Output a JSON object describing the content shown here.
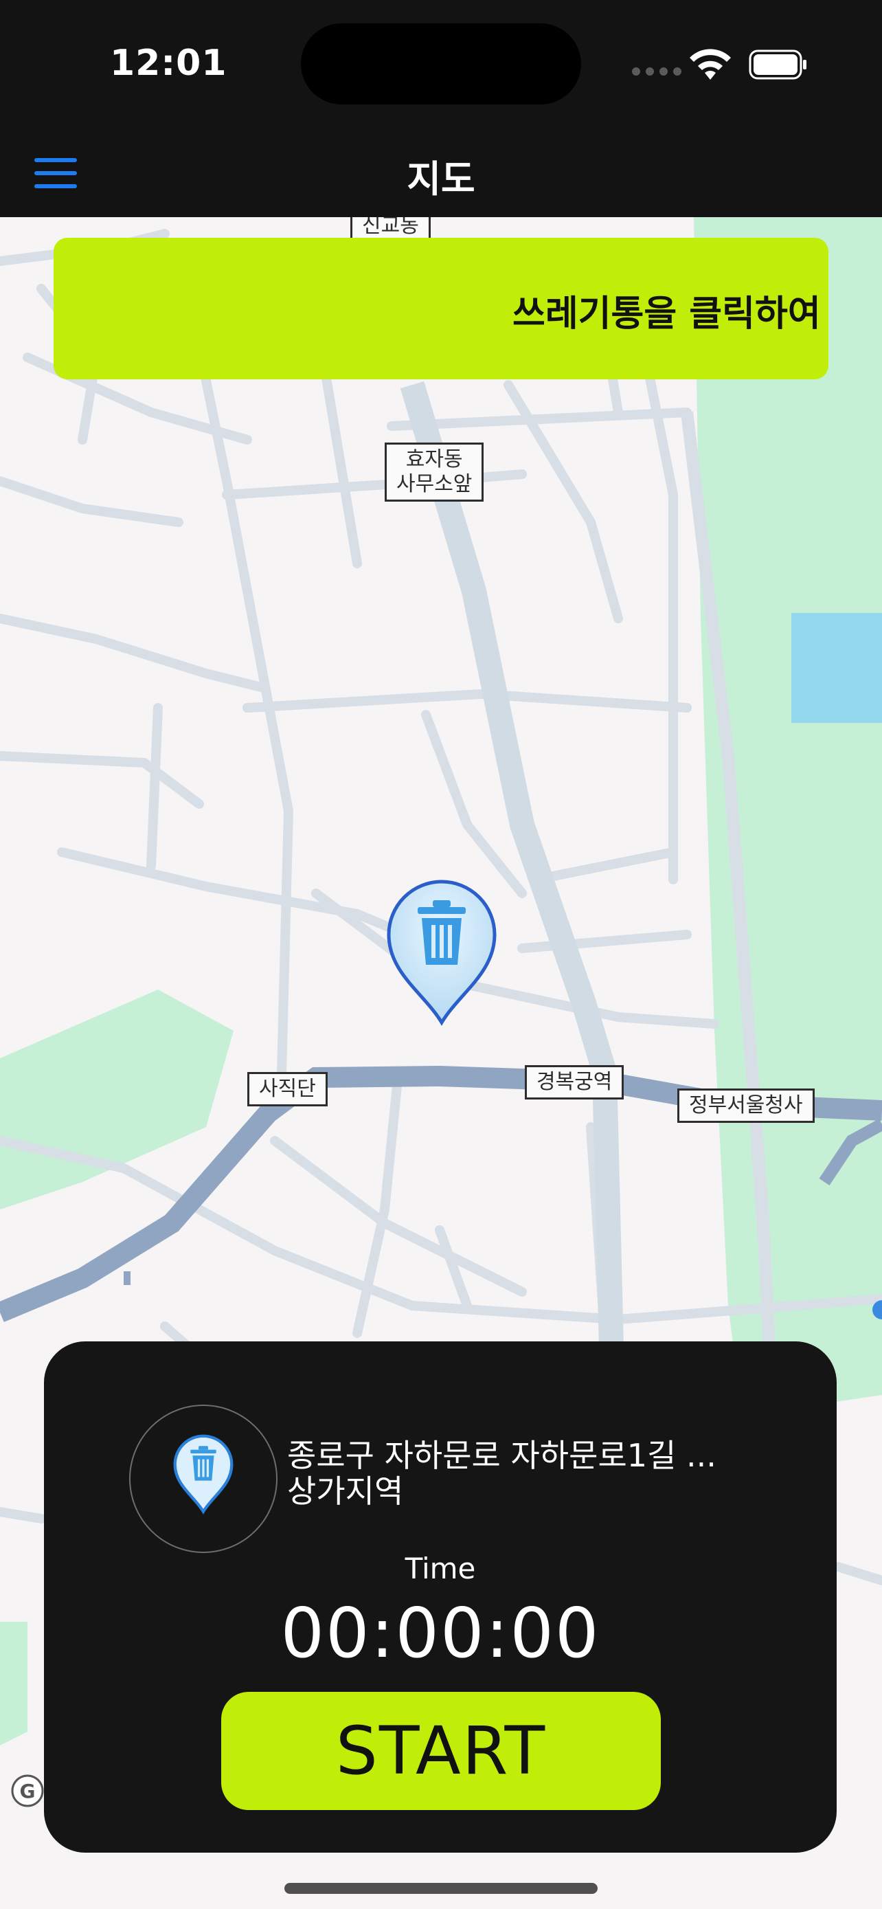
{
  "status_bar": {
    "time": "12:01"
  },
  "nav": {
    "title": "지도"
  },
  "banner": {
    "text": "쓰레기통을 클릭하여"
  },
  "map": {
    "labels": {
      "top_cut": "신교동",
      "hyoja": "효자동\n사무소앞",
      "sajik": "사직단",
      "gyeongbok": "경복궁역",
      "gov": "정부서울청사"
    }
  },
  "panel": {
    "address_line1": "종로구 자하문로 자하문로1길 ...",
    "address_line2": "상가지역",
    "time_label": "Time",
    "timer": "00:00:00",
    "start_label": "START"
  },
  "colors": {
    "accent": "#c1ee08",
    "nav_bg": "#131313",
    "pin_blue": "#3a9be2",
    "menu_blue": "#1e7cf0"
  },
  "icons": [
    "hamburger-menu-icon",
    "wifi-icon",
    "battery-icon",
    "trash-pin-icon"
  ]
}
